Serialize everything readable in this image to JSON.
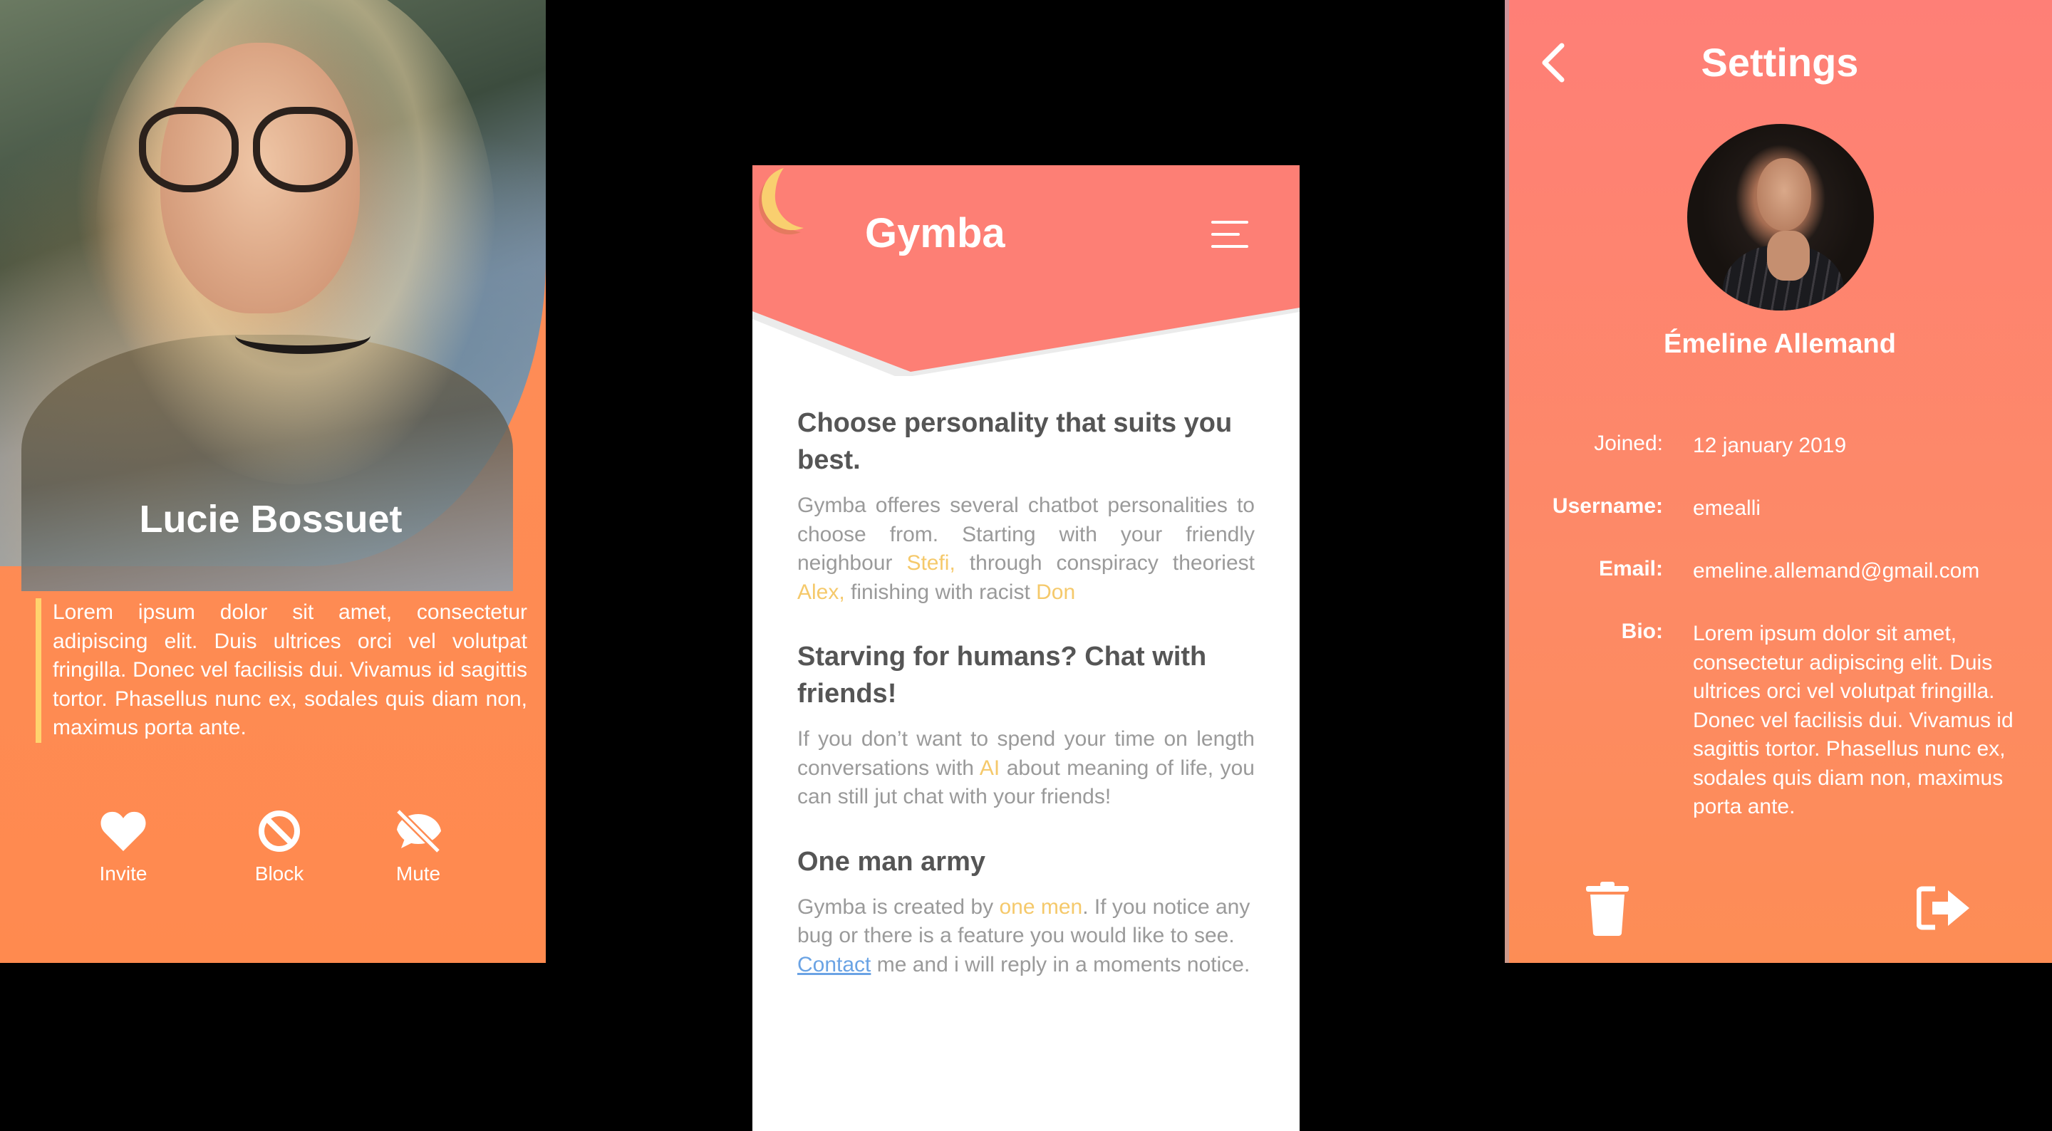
{
  "profile": {
    "name": "Lucie Bossuet",
    "bio": "Lorem ipsum dolor sit amet, consectetur adipiscing elit. Duis ultrices orci vel volutpat fringilla. Donec vel facilisis dui. Vivamus id sagittis tortor. Phasellus nunc ex, sodales quis diam non, maximus porta ante.",
    "accent_color": "#ffd36e",
    "actions": [
      {
        "label": "Invite",
        "icon": "heart-icon"
      },
      {
        "label": "Block",
        "icon": "block-icon"
      },
      {
        "label": "Mute",
        "icon": "mute-icon"
      }
    ]
  },
  "gymba": {
    "brand": "Gymba",
    "header_color": "#fd7f75",
    "logo_color": "#f9cf6f",
    "menu_icon": "hamburger-icon",
    "sections": [
      {
        "heading": "Choose personality that suits you best.",
        "text_parts": [
          "Gymba offeres several chatbot personalities to choose from. Starting with your friendly neighbour ",
          "Stefi,",
          " through conspiracy theoriest ",
          "Alex,",
          " finishing with racist ",
          "Don"
        ]
      },
      {
        "heading": "Starving for humans? Chat with friends!",
        "text_parts": [
          "If you don’t want to spend your time on length  conversations with ",
          "AI",
          " about meaning of life, you can still jut chat with your friends!"
        ]
      },
      {
        "heading": "One man army",
        "text_parts": [
          "Gymba is created by ",
          "one men",
          ". If you notice any bug or there is a feature you would like to see. ",
          "Contact",
          " me and i will reply in a moments notice."
        ]
      }
    ],
    "highlight_color": "#f5c96b",
    "link_color": "#6aa3e4"
  },
  "settings": {
    "title": "Settings",
    "back_icon": "chevron-left-icon",
    "full_name": "Émeline Allemand",
    "fields": [
      {
        "key": "Joined:",
        "value": "12 january 2019"
      },
      {
        "key": "Username:",
        "value": "emealli"
      },
      {
        "key": "Email:",
        "value": "emeline.allemand@gmail.com"
      },
      {
        "key": "Bio:",
        "value": "Lorem ipsum dolor sit amet, consectetur adipiscing elit. Duis ultrices orci vel volutpat fringilla. Donec vel facilisis dui. Vivamus id sagittis tortor. Phasellus nunc ex, sodales quis diam non, maximus porta ante."
      }
    ],
    "delete_icon": "trash-icon",
    "signout_icon": "sign-out-icon"
  }
}
